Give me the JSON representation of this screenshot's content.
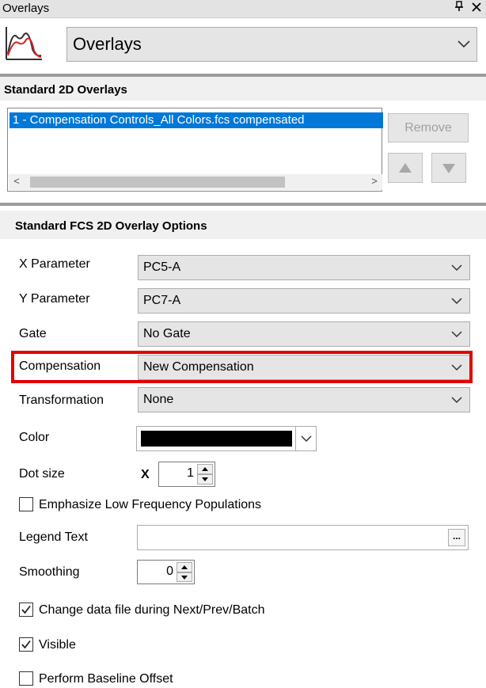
{
  "titlebar": {
    "title": "Overlays",
    "pin_icon": "pin-icon",
    "close_icon": "close-icon"
  },
  "header": {
    "icon": "histogram-overlay-icon",
    "selected": "Overlays"
  },
  "standard_2d": {
    "section_title": "Standard 2D Overlays",
    "items": [
      "1 - Compensation Controls_All Colors.fcs compensated"
    ],
    "remove_label": "Remove",
    "move_up_icon": "triangle-up-icon",
    "move_down_icon": "triangle-down-icon"
  },
  "options": {
    "section_title": "Standard FCS 2D Overlay Options",
    "x_param": {
      "label": "X Parameter",
      "value": "PC5-A"
    },
    "y_param": {
      "label": "Y Parameter",
      "value": "PC7-A"
    },
    "gate": {
      "label": "Gate",
      "value": "No Gate"
    },
    "compensation": {
      "label": "Compensation",
      "value": "New Compensation"
    },
    "transformation": {
      "label": "Transformation",
      "value": "None"
    },
    "color": {
      "label": "Color",
      "value": "#000000"
    },
    "dot_size": {
      "label": "Dot size",
      "prefix": "X",
      "value": "1"
    },
    "emphasize": {
      "label": "Emphasize Low Frequency Populations",
      "checked": false
    },
    "legend_text": {
      "label": "Legend Text",
      "value": "",
      "button": "..."
    },
    "smoothing": {
      "label": "Smoothing",
      "value": "0"
    },
    "change_data_file": {
      "label": "Change data file during Next/Prev/Batch",
      "checked": true
    },
    "visible": {
      "label": "Visible",
      "checked": true
    },
    "baseline_offset": {
      "label": "Perform Baseline Offset",
      "checked": false
    }
  },
  "colors": {
    "selection": "#0078d7",
    "highlight": "#e30000"
  }
}
